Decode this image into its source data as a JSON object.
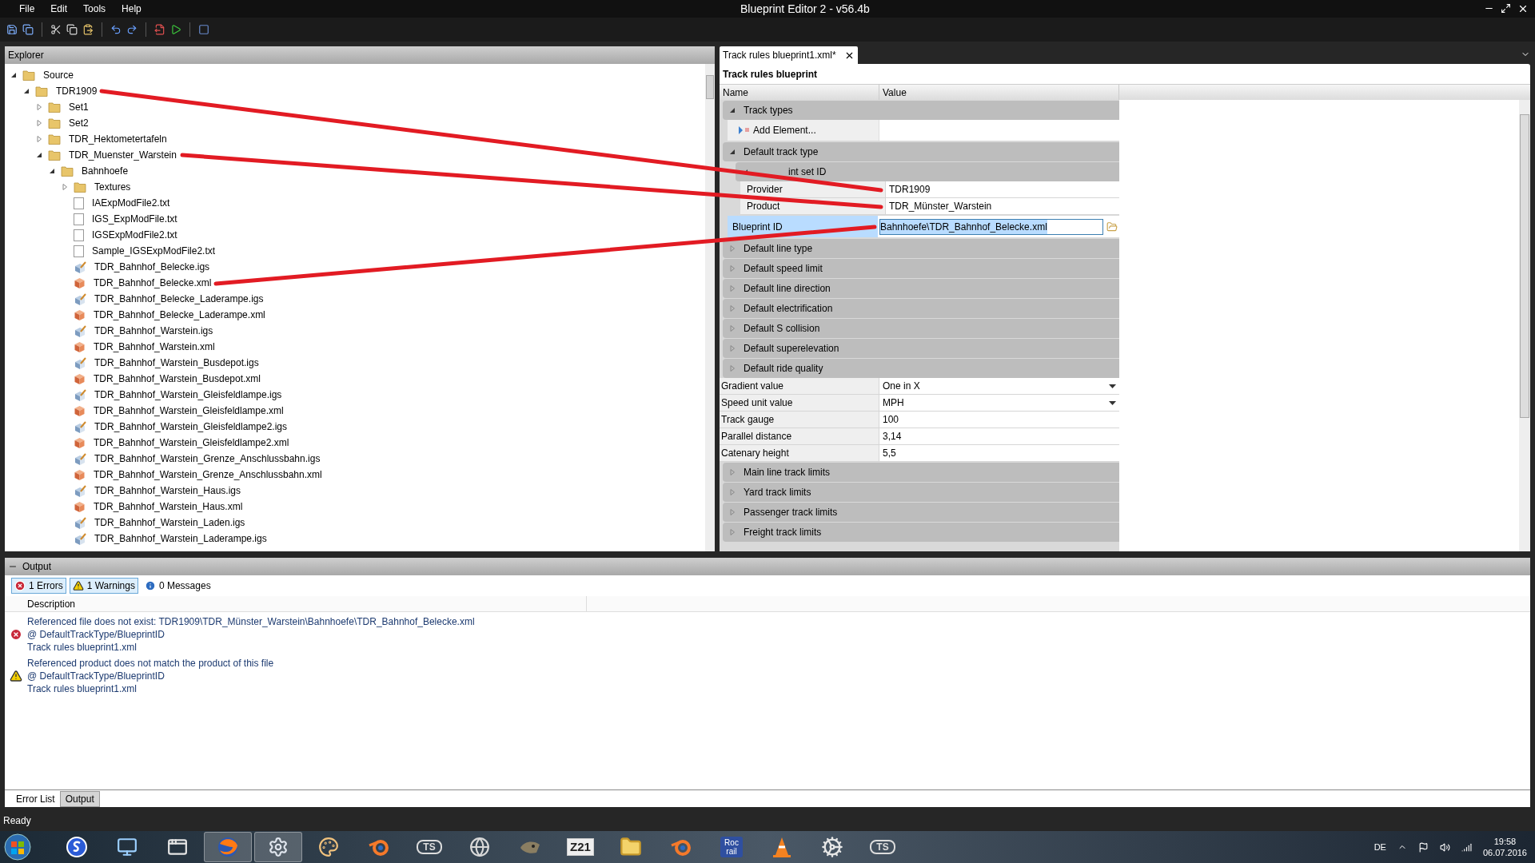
{
  "window": {
    "title": "Blueprint Editor 2 - v56.4b"
  },
  "menu": [
    "File",
    "Edit",
    "Tools",
    "Help"
  ],
  "explorer": {
    "title": "Explorer",
    "tree": [
      {
        "label": "Source",
        "kind": "folder",
        "expanded": true,
        "children": [
          {
            "label": "TDR1909",
            "kind": "folder",
            "expanded": true,
            "children": [
              {
                "label": "Set1",
                "kind": "folder",
                "expanded": false
              },
              {
                "label": "Set2",
                "kind": "folder",
                "expanded": false
              },
              {
                "label": "TDR_Hektometertafeln",
                "kind": "folder",
                "expanded": false
              },
              {
                "label": "TDR_Muenster_Warstein",
                "kind": "folder",
                "expanded": true,
                "children": [
                  {
                    "label": "Bahnhoefe",
                    "kind": "folder",
                    "expanded": true,
                    "children": [
                      {
                        "label": "Textures",
                        "kind": "folder",
                        "expanded": false
                      },
                      {
                        "label": "IAExpModFile2.txt",
                        "kind": "text"
                      },
                      {
                        "label": "IGS_ExpModFile.txt",
                        "kind": "text"
                      },
                      {
                        "label": "IGSExpModFile2.txt",
                        "kind": "text"
                      },
                      {
                        "label": "Sample_IGSExpModFile2.txt",
                        "kind": "text"
                      },
                      {
                        "label": "TDR_Bahnhof_Belecke.igs",
                        "kind": "igs"
                      },
                      {
                        "label": "TDR_Bahnhof_Belecke.xml",
                        "kind": "xml"
                      },
                      {
                        "label": "TDR_Bahnhof_Belecke_Laderampe.igs",
                        "kind": "igs"
                      },
                      {
                        "label": "TDR_Bahnhof_Belecke_Laderampe.xml",
                        "kind": "xml"
                      },
                      {
                        "label": "TDR_Bahnhof_Warstein.igs",
                        "kind": "igs"
                      },
                      {
                        "label": "TDR_Bahnhof_Warstein.xml",
                        "kind": "xml"
                      },
                      {
                        "label": "TDR_Bahnhof_Warstein_Busdepot.igs",
                        "kind": "igs"
                      },
                      {
                        "label": "TDR_Bahnhof_Warstein_Busdepot.xml",
                        "kind": "xml"
                      },
                      {
                        "label": "TDR_Bahnhof_Warstein_Gleisfeldlampe.igs",
                        "kind": "igs"
                      },
                      {
                        "label": "TDR_Bahnhof_Warstein_Gleisfeldlampe.xml",
                        "kind": "xml"
                      },
                      {
                        "label": "TDR_Bahnhof_Warstein_Gleisfeldlampe2.igs",
                        "kind": "igs"
                      },
                      {
                        "label": "TDR_Bahnhof_Warstein_Gleisfeldlampe2.xml",
                        "kind": "xml"
                      },
                      {
                        "label": "TDR_Bahnhof_Warstein_Grenze_Anschlussbahn.igs",
                        "kind": "igs"
                      },
                      {
                        "label": "TDR_Bahnhof_Warstein_Grenze_Anschlussbahn.xml",
                        "kind": "xml"
                      },
                      {
                        "label": "TDR_Bahnhof_Warstein_Haus.igs",
                        "kind": "igs"
                      },
                      {
                        "label": "TDR_Bahnhof_Warstein_Haus.xml",
                        "kind": "xml"
                      },
                      {
                        "label": "TDR_Bahnhof_Warstein_Laden.igs",
                        "kind": "igs"
                      },
                      {
                        "label": "TDR_Bahnhof_Warstein_Laderampe.igs",
                        "kind": "igs"
                      }
                    ]
                  }
                ]
              }
            ]
          }
        ]
      }
    ]
  },
  "document_tabs": [
    {
      "label": "Track rules blueprint1.xml*",
      "selected": true
    }
  ],
  "property_grid": {
    "title": "Track rules blueprint",
    "columns": [
      "Name",
      "Value"
    ],
    "rows": [
      {
        "kind": "category",
        "label": "Track types",
        "expanded": true,
        "children": [
          {
            "kind": "action",
            "label": "Add Element..."
          }
        ]
      },
      {
        "kind": "category",
        "label": "Default track type",
        "expanded": true,
        "children": [
          {
            "kind": "category",
            "label": "int set ID",
            "expanded": true,
            "children": [
              {
                "kind": "text",
                "name": "Provider",
                "value": "TDR1909"
              },
              {
                "kind": "text",
                "name": "Product",
                "value": "TDR_Münster_Warstein"
              }
            ]
          },
          {
            "kind": "path",
            "name": "Blueprint ID",
            "value": "Bahnhoefe\\TDR_Bahnhof_Belecke.xml",
            "selected": true
          }
        ]
      },
      {
        "kind": "category",
        "label": "Default line type",
        "expanded": false
      },
      {
        "kind": "category",
        "label": "Default speed limit",
        "expanded": false
      },
      {
        "kind": "category",
        "label": "Default line direction",
        "expanded": false
      },
      {
        "kind": "category",
        "label": "Default electrification",
        "expanded": false
      },
      {
        "kind": "category",
        "label": "Default S collision",
        "expanded": false
      },
      {
        "kind": "category",
        "label": "Default superelevation",
        "expanded": false
      },
      {
        "kind": "category",
        "label": "Default ride quality",
        "expanded": false
      },
      {
        "kind": "dropdown",
        "name": "Gradient value",
        "value": "One in X"
      },
      {
        "kind": "dropdown",
        "name": "Speed unit value",
        "value": "MPH"
      },
      {
        "kind": "text",
        "name": "Track gauge",
        "value": "100"
      },
      {
        "kind": "text",
        "name": "Parallel distance",
        "value": "3,14"
      },
      {
        "kind": "text",
        "name": "Catenary height",
        "value": "5,5"
      },
      {
        "kind": "category",
        "label": "Main line track limits",
        "expanded": false
      },
      {
        "kind": "category",
        "label": "Yard track limits",
        "expanded": false
      },
      {
        "kind": "category",
        "label": "Passenger track limits",
        "expanded": false
      },
      {
        "kind": "category",
        "label": "Freight track limits",
        "expanded": false
      }
    ]
  },
  "output": {
    "title": "Output",
    "filters": [
      {
        "kind": "error",
        "label": "1 Errors",
        "selected": true
      },
      {
        "kind": "warning",
        "label": "1 Warnings",
        "selected": true
      },
      {
        "kind": "info",
        "label": "0 Messages",
        "selected": false
      }
    ],
    "columns": [
      "Description"
    ],
    "entries": [
      {
        "kind": "error",
        "lines": [
          "Referenced file does not exist: TDR1909\\TDR_Münster_Warstein\\Bahnhoefe\\TDR_Bahnhof_Belecke.xml",
          "@ DefaultTrackType/BlueprintID",
          "Track rules blueprint1.xml"
        ]
      },
      {
        "kind": "warning",
        "lines": [
          "Referenced product does not match the product of this file",
          "@ DefaultTrackType/BlueprintID",
          "Track rules blueprint1.xml"
        ]
      }
    ],
    "tabs": [
      {
        "label": "Error List",
        "selected": true
      },
      {
        "label": "Output",
        "selected": false
      }
    ]
  },
  "status_bar": "Ready",
  "taskbar": {
    "apps": [
      {
        "kind": "s-app",
        "active": false
      },
      {
        "kind": "monitor",
        "active": false
      },
      {
        "kind": "window",
        "active": false
      },
      {
        "kind": "browser",
        "active": true
      },
      {
        "kind": "gear",
        "active": true
      },
      {
        "kind": "palette",
        "active": false
      },
      {
        "kind": "blender",
        "active": false
      },
      {
        "kind": "badge",
        "label": "TS",
        "active": false
      },
      {
        "kind": "sphere",
        "active": false
      },
      {
        "kind": "animal",
        "active": false
      },
      {
        "kind": "badge-z",
        "label": "Z21",
        "active": false
      },
      {
        "kind": "folder",
        "active": false
      },
      {
        "kind": "blender",
        "active": false
      },
      {
        "kind": "tile",
        "label": "Roc rail",
        "active": false
      },
      {
        "kind": "cone",
        "active": false
      },
      {
        "kind": "gears",
        "active": false
      },
      {
        "kind": "badge",
        "label": "TS",
        "active": false
      }
    ],
    "language": "DE",
    "time": "19:58",
    "date": "06.07.2016"
  }
}
